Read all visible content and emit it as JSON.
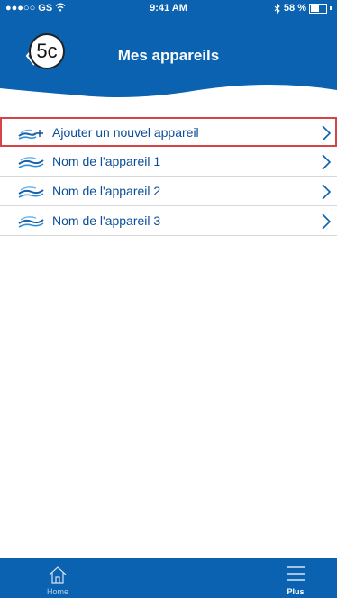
{
  "status_bar": {
    "carrier": "●●●○○ GS",
    "time": "9:41 AM",
    "battery": "58 %",
    "battery_level": 0.58
  },
  "header": {
    "title": "Mes appareils",
    "step_badge": "5c"
  },
  "devices": [
    {
      "label": "Ajouter un nouvel appareil",
      "icon": "add-device-icon"
    },
    {
      "label": "Nom de l'appareil 1",
      "icon": "device-wave-icon"
    },
    {
      "label": "Nom de l'appareil 2",
      "icon": "device-wave-icon"
    },
    {
      "label": "Nom de l'appareil 3",
      "icon": "device-wave-icon"
    }
  ],
  "tab_bar": {
    "home_label": "Home",
    "more_label": "Plus"
  },
  "colors": {
    "primary": "#0a62b1",
    "highlight": "#d64545",
    "text": "#0b4e98"
  }
}
